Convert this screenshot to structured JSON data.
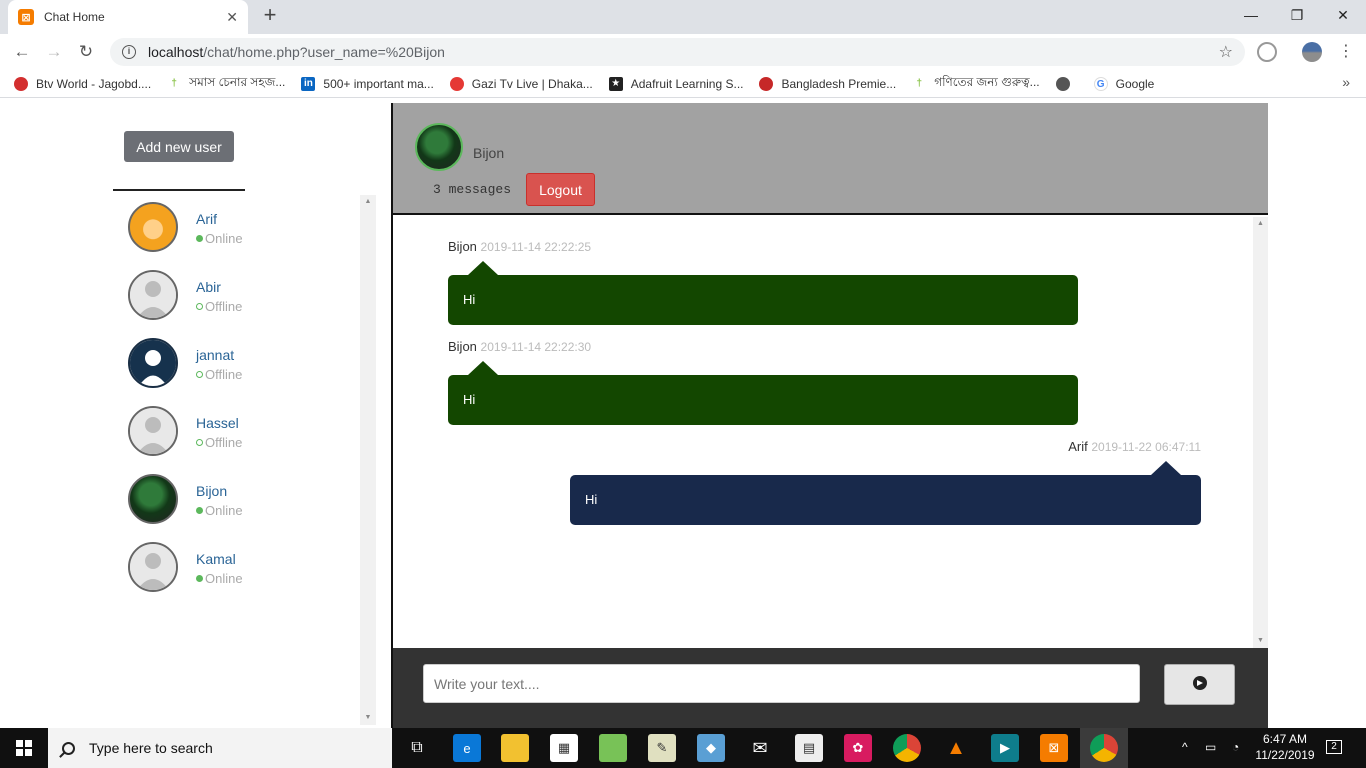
{
  "browser": {
    "tab_title": "Chat Home",
    "url_host": "localhost",
    "url_path": "/chat/home.php?user_name=%20Bijon",
    "bookmarks": [
      {
        "label": "Btv World - Jagobd....",
        "color": "#d32f2f"
      },
      {
        "label": "সমাস চেনার সহজ...",
        "color": "#8bc34a"
      },
      {
        "label": "500+ important ma...",
        "color": "#0a66c2"
      },
      {
        "label": "Gazi Tv Live | Dhaka...",
        "color": "#e53935"
      },
      {
        "label": "Adafruit Learning S...",
        "color": "#222222"
      },
      {
        "label": "Bangladesh Premie...",
        "color": "#c62828"
      },
      {
        "label": "গণিতের জন্য গুরুত্ব...",
        "color": "#8bc34a"
      },
      {
        "label": "",
        "color": "#555555"
      },
      {
        "label": "Google",
        "color": "#4285f4"
      }
    ],
    "bookmarks_more": "»"
  },
  "sidebar": {
    "add_user_label": "Add new user",
    "users": [
      {
        "name": "Arif",
        "status": "Online",
        "online": true,
        "avatar": "orange"
      },
      {
        "name": "Abir",
        "status": "Offline",
        "online": false,
        "avatar": "default"
      },
      {
        "name": "jannat",
        "status": "Offline",
        "online": false,
        "avatar": "dark"
      },
      {
        "name": "Hassel",
        "status": "Offline",
        "online": false,
        "avatar": "default"
      },
      {
        "name": "Bijon",
        "status": "Online",
        "online": true,
        "avatar": "photo"
      },
      {
        "name": "Kamal",
        "status": "Online",
        "online": true,
        "avatar": "default"
      }
    ]
  },
  "chat": {
    "me_name": "Bijon",
    "message_count": "3 messages",
    "logout_label": "Logout",
    "messages": [
      {
        "sender": "Bijon",
        "time": "2019-11-14 22:22:25",
        "text": "Hi",
        "mine": false
      },
      {
        "sender": "Bijon",
        "time": "2019-11-14 22:22:30",
        "text": "Hi",
        "mine": false
      },
      {
        "sender": "Arif",
        "time": "2019-11-22 06:47:11",
        "text": "Hi",
        "mine": true
      }
    ],
    "input_placeholder": "Write your text....",
    "colors": {
      "header": "#a2a2a2",
      "incoming": "#134700",
      "outgoing": "#18294b",
      "logout": "#d9534f",
      "composer": "#333333"
    }
  },
  "taskbar": {
    "search_placeholder": "Type here to search",
    "time": "6:47 AM",
    "date": "11/22/2019",
    "notifications": "2"
  }
}
